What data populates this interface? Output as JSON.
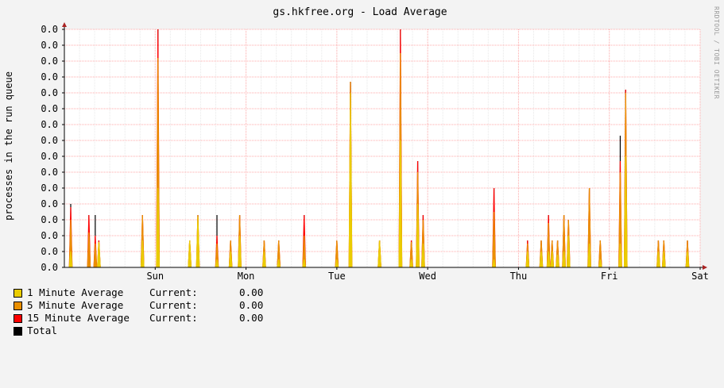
{
  "chart_data": {
    "type": "area",
    "title": "gs.hkfree.org - Load Average",
    "ylabel": "processes in the run queue",
    "watermark": "RRDTOOL / TOBI OETIKER",
    "y_tick_labels": [
      "0.0",
      "0.0",
      "0.0",
      "0.0",
      "0.0",
      "0.0",
      "0.0",
      "0.0",
      "0.0",
      "0.0",
      "0.0",
      "0.0",
      "0.0",
      "0.0",
      "0.0",
      "0.0"
    ],
    "ylim": [
      0,
      15
    ],
    "x_tick_labels": [
      "Sun",
      "Mon",
      "Tue",
      "Wed",
      "Thu",
      "Fri",
      "Sat"
    ],
    "x_tick_positions_days": [
      1,
      2,
      3,
      4,
      5,
      6,
      7
    ],
    "xlim_days": [
      0,
      7
    ],
    "grid": true,
    "legend_placement": "bottom-left",
    "colors": {
      "load_1min": "#eacc00",
      "load_5min": "#ea8f00",
      "load_15min": "#ff0000",
      "total": "#000000",
      "grid": "#ffaaaa",
      "axis": "#000000",
      "arrow": "#aa2222",
      "background": "#f3f3f3",
      "plot_background": "#ffffff"
    },
    "spikes": [
      {
        "x": 0.07,
        "total": 4.0,
        "min15": 3.8,
        "min5": 3.0,
        "min1": 1.0
      },
      {
        "x": 0.27,
        "total": 3.3,
        "min15": 3.3,
        "min5": 2.2,
        "min1": 0.0
      },
      {
        "x": 0.34,
        "total": 3.3,
        "min15": 2.0,
        "min5": 1.5,
        "min1": 0.0
      },
      {
        "x": 0.38,
        "total": 1.7,
        "min15": 1.7,
        "min5": 1.6,
        "min1": 1.6
      },
      {
        "x": 0.86,
        "total": 3.3,
        "min15": 3.3,
        "min5": 3.3,
        "min1": 1.7
      },
      {
        "x": 1.03,
        "total": 15.0,
        "min15": 15.0,
        "min5": 13.2,
        "min1": 5.0
      },
      {
        "x": 1.38,
        "total": 1.7,
        "min15": 1.7,
        "min5": 1.7,
        "min1": 1.7
      },
      {
        "x": 1.47,
        "total": 3.3,
        "min15": 3.3,
        "min5": 3.3,
        "min1": 3.2
      },
      {
        "x": 1.68,
        "total": 3.3,
        "min15": 2.0,
        "min5": 1.5,
        "min1": 0.5
      },
      {
        "x": 1.83,
        "total": 1.7,
        "min15": 1.7,
        "min5": 1.7,
        "min1": 1.0
      },
      {
        "x": 1.93,
        "total": 3.3,
        "min15": 3.3,
        "min5": 3.3,
        "min1": 2.0
      },
      {
        "x": 2.2,
        "total": 1.7,
        "min15": 1.7,
        "min5": 1.7,
        "min1": 1.0
      },
      {
        "x": 2.36,
        "total": 1.7,
        "min15": 1.7,
        "min5": 1.7,
        "min1": 0.5
      },
      {
        "x": 2.64,
        "total": 3.3,
        "min15": 3.3,
        "min5": 2.0,
        "min1": 0.5
      },
      {
        "x": 3.0,
        "total": 1.7,
        "min15": 1.7,
        "min5": 1.7,
        "min1": 0.5
      },
      {
        "x": 3.15,
        "total": 11.7,
        "min15": 11.7,
        "min5": 11.7,
        "min1": 11.0
      },
      {
        "x": 3.47,
        "total": 1.7,
        "min15": 1.7,
        "min5": 1.7,
        "min1": 1.7
      },
      {
        "x": 3.7,
        "total": 15.0,
        "min15": 15.0,
        "min5": 13.5,
        "min1": 8.0
      },
      {
        "x": 3.82,
        "total": 1.7,
        "min15": 1.7,
        "min5": 1.6,
        "min1": 0.5
      },
      {
        "x": 3.89,
        "total": 6.7,
        "min15": 6.7,
        "min5": 6.0,
        "min1": 4.0
      },
      {
        "x": 3.95,
        "total": 3.3,
        "min15": 3.3,
        "min5": 3.0,
        "min1": 1.5
      },
      {
        "x": 4.73,
        "total": 5.0,
        "min15": 5.0,
        "min5": 3.5,
        "min1": 0.5
      },
      {
        "x": 5.1,
        "total": 1.7,
        "min15": 1.7,
        "min5": 1.5,
        "min1": 1.0
      },
      {
        "x": 5.25,
        "total": 1.7,
        "min15": 1.7,
        "min5": 1.7,
        "min1": 1.0
      },
      {
        "x": 5.33,
        "total": 3.3,
        "min15": 3.3,
        "min5": 2.8,
        "min1": 1.0
      },
      {
        "x": 5.37,
        "total": 1.7,
        "min15": 1.7,
        "min5": 1.7,
        "min1": 1.0
      },
      {
        "x": 5.43,
        "total": 1.7,
        "min15": 1.7,
        "min5": 1.7,
        "min1": 0.8
      },
      {
        "x": 5.5,
        "total": 3.3,
        "min15": 3.3,
        "min5": 3.3,
        "min1": 1.0
      },
      {
        "x": 5.55,
        "total": 3.0,
        "min15": 3.0,
        "min5": 3.0,
        "min1": 2.0
      },
      {
        "x": 5.78,
        "total": 5.0,
        "min15": 5.0,
        "min5": 5.0,
        "min1": 1.5
      },
      {
        "x": 5.9,
        "total": 1.7,
        "min15": 1.7,
        "min5": 1.7,
        "min1": 0.5
      },
      {
        "x": 6.12,
        "total": 8.3,
        "min15": 6.7,
        "min5": 6.0,
        "min1": 1.5
      },
      {
        "x": 6.18,
        "total": 11.2,
        "min15": 11.2,
        "min5": 11.0,
        "min1": 7.0
      },
      {
        "x": 6.54,
        "total": 1.7,
        "min15": 1.7,
        "min5": 1.7,
        "min1": 1.0
      },
      {
        "x": 6.6,
        "total": 1.7,
        "min15": 1.7,
        "min5": 1.7,
        "min1": 1.0
      },
      {
        "x": 6.86,
        "total": 1.7,
        "min15": 1.7,
        "min5": 1.7,
        "min1": 1.0
      }
    ]
  },
  "legend": {
    "items": [
      {
        "name": "1 Minute Average",
        "color": "#eacc00",
        "current_label": "Current:",
        "current_value": "0.00"
      },
      {
        "name": "5 Minute Average",
        "color": "#ea8f00",
        "current_label": "Current:",
        "current_value": "0.00"
      },
      {
        "name": "15 Minute Average",
        "color": "#ff0000",
        "current_label": "Current:",
        "current_value": "0.00"
      },
      {
        "name": "Total",
        "color": "#000000",
        "current_label": "",
        "current_value": ""
      }
    ]
  }
}
